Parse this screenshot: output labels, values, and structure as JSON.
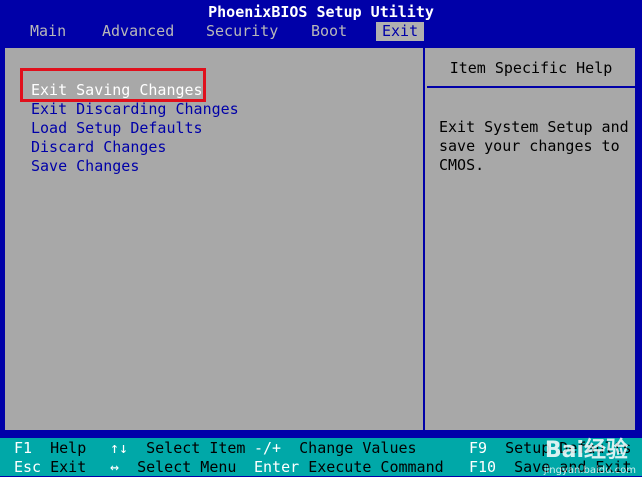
{
  "title": "PhoenixBIOS Setup Utility",
  "menu": {
    "items": [
      "Main",
      "Advanced",
      "Security",
      "Boot",
      "Exit"
    ],
    "active": "Exit"
  },
  "options": [
    "Exit Saving Changes",
    "Exit Discarding Changes",
    "Load Setup Defaults",
    "Discard Changes",
    "Save Changes"
  ],
  "help": {
    "title": "Item Specific Help",
    "text": "Exit System Setup and\nsave your changes to\nCMOS."
  },
  "footer": {
    "row1": [
      {
        "key": "F1",
        "label": "Help"
      },
      {
        "key": "↑↓",
        "label": "Select Item"
      },
      {
        "key": "-/+",
        "label": "Change Values"
      },
      {
        "key": "F9",
        "label": "Setup Defaults"
      }
    ],
    "row2": [
      {
        "key": "Esc",
        "label": "Exit"
      },
      {
        "key": "↔",
        "label": "Select Menu"
      },
      {
        "key": "Enter",
        "label": "Execute Command"
      },
      {
        "key": "F10",
        "label": "Save and Exit"
      }
    ]
  },
  "watermark": {
    "brand": "Bai经验",
    "url": "jingyan.baidu.com"
  },
  "colors": {
    "background": "#0000a8",
    "panel": "#a8a8a8",
    "footer": "#00a8a8",
    "highlight": "#e0101c"
  }
}
